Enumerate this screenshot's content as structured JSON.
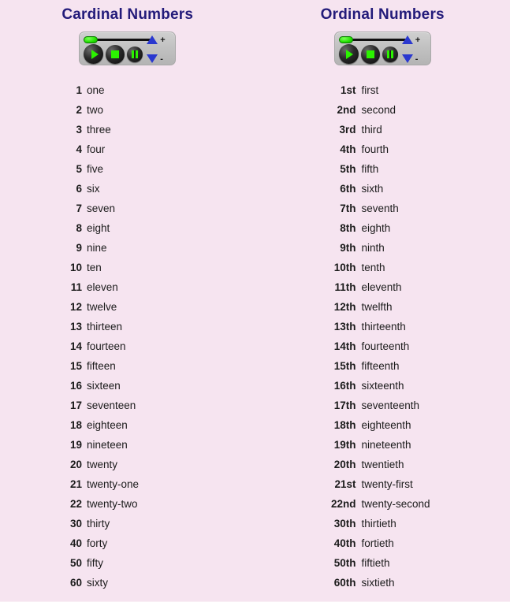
{
  "page": {
    "background_color": "#f6e4f0",
    "title_color": "#231b7a",
    "accent_green": "#2bf200",
    "accent_blue": "#2a38cf"
  },
  "columns": [
    {
      "id": "cardinal",
      "title": "Cardinal Numbers",
      "player": {
        "play_label": "play-button",
        "stop_label": "stop-button",
        "pause_label": "pause-button",
        "plus_label": "+",
        "minus_label": "-"
      },
      "rows": [
        {
          "num": "1",
          "word": "one"
        },
        {
          "num": "2",
          "word": "two"
        },
        {
          "num": "3",
          "word": "three"
        },
        {
          "num": "4",
          "word": "four"
        },
        {
          "num": "5",
          "word": "five"
        },
        {
          "num": "6",
          "word": "six"
        },
        {
          "num": "7",
          "word": "seven"
        },
        {
          "num": "8",
          "word": "eight"
        },
        {
          "num": "9",
          "word": "nine"
        },
        {
          "num": "10",
          "word": "ten"
        },
        {
          "num": "11",
          "word": "eleven"
        },
        {
          "num": "12",
          "word": "twelve"
        },
        {
          "num": "13",
          "word": "thirteen"
        },
        {
          "num": "14",
          "word": "fourteen"
        },
        {
          "num": "15",
          "word": "fifteen"
        },
        {
          "num": "16",
          "word": "sixteen"
        },
        {
          "num": "17",
          "word": "seventeen"
        },
        {
          "num": "18",
          "word": "eighteen"
        },
        {
          "num": "19",
          "word": "nineteen"
        },
        {
          "num": "20",
          "word": "twenty"
        },
        {
          "num": "21",
          "word": "twenty-one"
        },
        {
          "num": "22",
          "word": "twenty-two"
        },
        {
          "num": "30",
          "word": "thirty"
        },
        {
          "num": "40",
          "word": "forty"
        },
        {
          "num": "50",
          "word": "fifty"
        },
        {
          "num": "60",
          "word": "sixty"
        }
      ]
    },
    {
      "id": "ordinal",
      "title": "Ordinal Numbers",
      "player": {
        "play_label": "play-button",
        "stop_label": "stop-button",
        "pause_label": "pause-button",
        "plus_label": "+",
        "minus_label": "-"
      },
      "rows": [
        {
          "num": "1st",
          "word": "first"
        },
        {
          "num": "2nd",
          "word": "second"
        },
        {
          "num": "3rd",
          "word": "third"
        },
        {
          "num": "4th",
          "word": "fourth"
        },
        {
          "num": "5th",
          "word": "fifth"
        },
        {
          "num": "6th",
          "word": "sixth"
        },
        {
          "num": "7th",
          "word": "seventh"
        },
        {
          "num": "8th",
          "word": "eighth"
        },
        {
          "num": "9th",
          "word": "ninth"
        },
        {
          "num": "10th",
          "word": "tenth"
        },
        {
          "num": "11th",
          "word": "eleventh"
        },
        {
          "num": "12th",
          "word": "twelfth"
        },
        {
          "num": "13th",
          "word": "thirteenth"
        },
        {
          "num": "14th",
          "word": "fourteenth"
        },
        {
          "num": "15th",
          "word": "fifteenth"
        },
        {
          "num": "16th",
          "word": "sixteenth"
        },
        {
          "num": "17th",
          "word": "seventeenth"
        },
        {
          "num": "18th",
          "word": "eighteenth"
        },
        {
          "num": "19th",
          "word": "nineteenth"
        },
        {
          "num": "20th",
          "word": "twentieth"
        },
        {
          "num": "21st",
          "word": "twenty-first"
        },
        {
          "num": "22nd",
          "word": "twenty-second"
        },
        {
          "num": "30th",
          "word": "thirtieth"
        },
        {
          "num": "40th",
          "word": "fortieth"
        },
        {
          "num": "50th",
          "word": "fiftieth"
        },
        {
          "num": "60th",
          "word": "sixtieth"
        }
      ]
    }
  ]
}
